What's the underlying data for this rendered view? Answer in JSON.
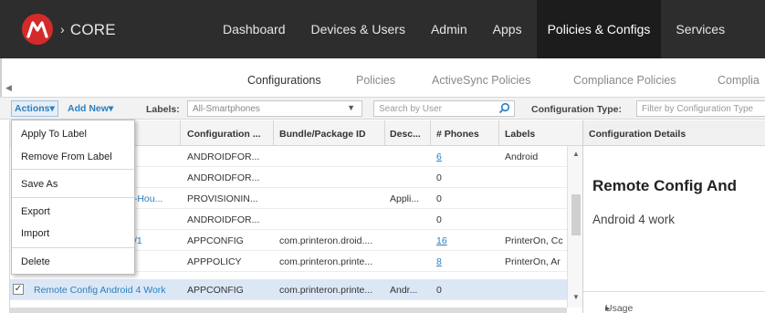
{
  "header": {
    "brand": "CORE",
    "nav": [
      "Dashboard",
      "Devices & Users",
      "Admin",
      "Apps",
      "Policies & Configs",
      "Services"
    ],
    "active_nav": "Policies & Configs"
  },
  "subtabs": [
    "Configurations",
    "Policies",
    "ActiveSync Policies",
    "Compliance Policies",
    "Complia"
  ],
  "toolbar": {
    "actions_label": "Actions",
    "add_new_label": "Add New",
    "labels_label": "Labels:",
    "labels_value": "All-Smartphones",
    "search_placeholder": "Search by User",
    "config_type_label": "Configuration Type:",
    "config_type_placeholder": "Filter by Configuration Type"
  },
  "menu": {
    "items": [
      "Apply To Label",
      "Remove From Label",
      "Save As",
      "Export",
      "Import",
      "Delete"
    ]
  },
  "grid": {
    "columns": [
      "Configuration ...",
      "Bundle/Package ID",
      "Desc...",
      "# Phones",
      "Labels"
    ],
    "rows": [
      {
        "name": "",
        "type": "ANDROIDFOR...",
        "bundle": "",
        "desc": "",
        "phones": "6",
        "labels": "Android"
      },
      {
        "name": "n",
        "type": "ANDROIDFOR...",
        "bundle": "",
        "desc": "",
        "phones": "0",
        "labels": ""
      },
      {
        "name": "n-Hou...",
        "type": "PROVISIONIN...",
        "bundle": "",
        "desc": "Appli...",
        "phones": "0",
        "labels": ""
      },
      {
        "name": "",
        "type": "ANDROIDFOR...",
        "bundle": "",
        "desc": "",
        "phones": "0",
        "labels": ""
      },
      {
        "name": "/1",
        "type": "APPCONFIG",
        "bundle": "com.printeron.droid....",
        "desc": "",
        "phones": "16",
        "labels": "PrinterOn, Cc"
      },
      {
        "name": "",
        "type": "APPPOLICY",
        "bundle": "com.printeron.printe...",
        "desc": "",
        "phones": "8",
        "labels": "PrinterOn, Ar"
      },
      {
        "name": "Remote Config Android 4 Work",
        "type": "APPCONFIG",
        "bundle": "com.printeron.printe...",
        "desc": "Andr...",
        "phones": "0",
        "labels": ""
      }
    ]
  },
  "details": {
    "header": "Configuration Details",
    "title": "Remote Config And",
    "subtitle": "Android 4 work",
    "usage": "Usage"
  },
  "colors": {
    "topbar": "#2d2d2d",
    "active_nav": "#1c1c1c",
    "logo": "#d42a2a",
    "link": "#2a7fc0",
    "selected_row": "#dce7f5"
  }
}
